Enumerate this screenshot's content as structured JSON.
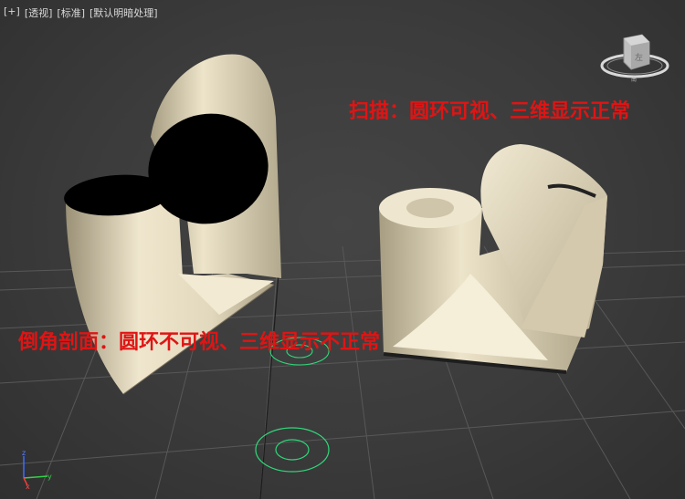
{
  "viewport": {
    "label_parts": [
      "[+]",
      "[透视]",
      "[标准]",
      "[默认明暗处理]"
    ]
  },
  "annotations": {
    "sweep": "扫描：圆环可视、三维显示正常",
    "bevel_profile": "倒角剖面：圆环不可视、三维显示不正常"
  },
  "viewcube": {
    "face_label": "左",
    "compass_label": "南"
  },
  "axis_gizmo": {
    "z_label": "z",
    "x_label": "x",
    "y_label": "y"
  },
  "colors": {
    "background": "#3a3a3a",
    "grid": "#5a5a5a",
    "object_fill": "#e6dcc2",
    "object_shadow": "#9d9378",
    "annotation": "#e01414",
    "circle_shape": "#2fd87a"
  }
}
